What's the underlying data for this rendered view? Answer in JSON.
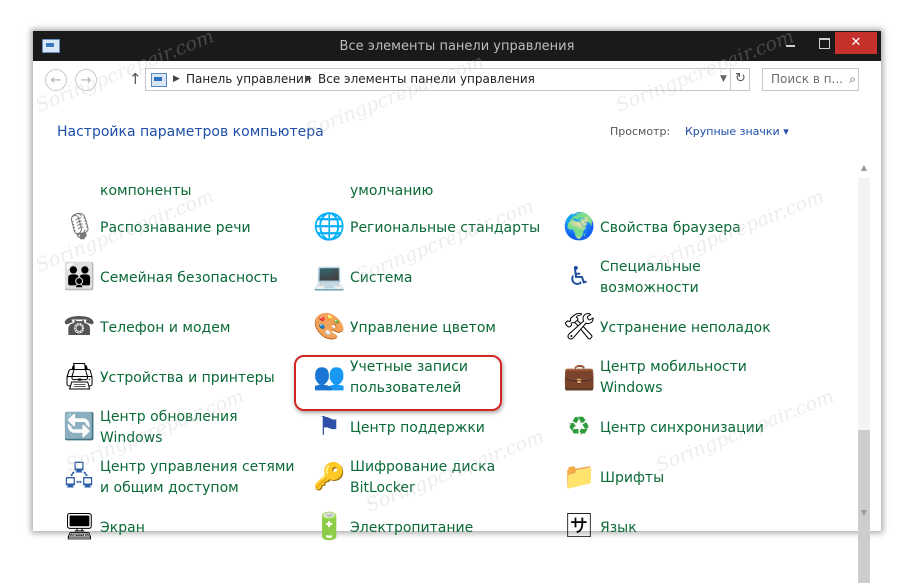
{
  "window": {
    "title": "Все элементы панели управления",
    "controls": {
      "minimize": "—",
      "maximize": "",
      "close": "✕"
    }
  },
  "addressbar": {
    "breadcrumbs": [
      "Панель управления",
      "Все элементы панели управления"
    ],
    "separator": "▶",
    "search_placeholder": "Поиск в п...",
    "icons": {
      "back": "arrow-left",
      "forward": "arrow-right",
      "up": "arrow-up",
      "refresh": "refresh",
      "search": "magnifier"
    }
  },
  "header": {
    "title": "Настройка параметров компьютера",
    "view_label": "Просмотр:",
    "view_value": "Крупные значки"
  },
  "items": {
    "cut": [
      {
        "label": "компоненты",
        "icon": "programs-icon"
      },
      {
        "label": "умолчанию",
        "icon": "default-programs-icon"
      },
      {
        "label": "",
        "icon": "cut-icon"
      }
    ],
    "col1": [
      {
        "label": "Распознавание речи",
        "icon": "microphone-icon",
        "glyph": "🎙"
      },
      {
        "label": "Семейная безопасность",
        "icon": "family-safety-icon",
        "glyph": "👨‍👩‍👧"
      },
      {
        "label": "Телефон и модем",
        "icon": "phone-modem-icon",
        "glyph": "☎"
      },
      {
        "label": "Устройства и принтеры",
        "icon": "printer-icon",
        "glyph": "🖨"
      },
      {
        "label_lines": [
          "Центр обновления",
          "Windows"
        ],
        "icon": "windows-update-icon",
        "glyph": "🔄"
      },
      {
        "label_lines": [
          "Центр управления сетями",
          "и общим доступом"
        ],
        "icon": "network-center-icon",
        "glyph": "🖧"
      },
      {
        "label": "Экран",
        "icon": "display-icon",
        "glyph": "🖥"
      }
    ],
    "col2": [
      {
        "label": "Региональные стандарты",
        "icon": "region-globe-icon",
        "glyph": "🌐"
      },
      {
        "label": "Система",
        "icon": "system-icon",
        "glyph": "💻"
      },
      {
        "label": "Управление цветом",
        "icon": "color-management-icon",
        "glyph": "🎨"
      },
      {
        "label_lines": [
          "Учетные записи",
          "пользователей"
        ],
        "icon": "user-accounts-icon",
        "glyph": "👥"
      },
      {
        "label": "Центр поддержки",
        "icon": "action-center-flag-icon",
        "glyph": "⚑"
      },
      {
        "label_lines": [
          "Шифрование диска",
          "BitLocker"
        ],
        "icon": "bitlocker-key-icon",
        "glyph": "🔑"
      },
      {
        "label": "Электропитание",
        "icon": "power-battery-icon",
        "glyph": "🔋"
      }
    ],
    "col3": [
      {
        "label": "Свойства браузера",
        "icon": "internet-options-icon",
        "glyph": "🌍"
      },
      {
        "label_lines": [
          "Специальные",
          "возможности"
        ],
        "icon": "accessibility-icon",
        "glyph": "♿"
      },
      {
        "label": "Устранение неполадок",
        "icon": "troubleshooting-icon",
        "glyph": "🛠"
      },
      {
        "label_lines": [
          "Центр мобильности",
          "Windows"
        ],
        "icon": "mobility-center-icon",
        "glyph": "💼"
      },
      {
        "label": "Центр синхронизации",
        "icon": "sync-center-icon",
        "glyph": "♻"
      },
      {
        "label": "Шрифты",
        "icon": "fonts-folder-icon",
        "glyph": "📁"
      },
      {
        "label": "Язык",
        "icon": "language-icon",
        "glyph": "🈂"
      }
    ]
  },
  "colors": {
    "link_green": "#0b6a38",
    "link_blue": "#1e4ea8",
    "highlight_red": "#d42525",
    "close_red": "#c7312b"
  },
  "watermark": "Soringpcrepair.com"
}
